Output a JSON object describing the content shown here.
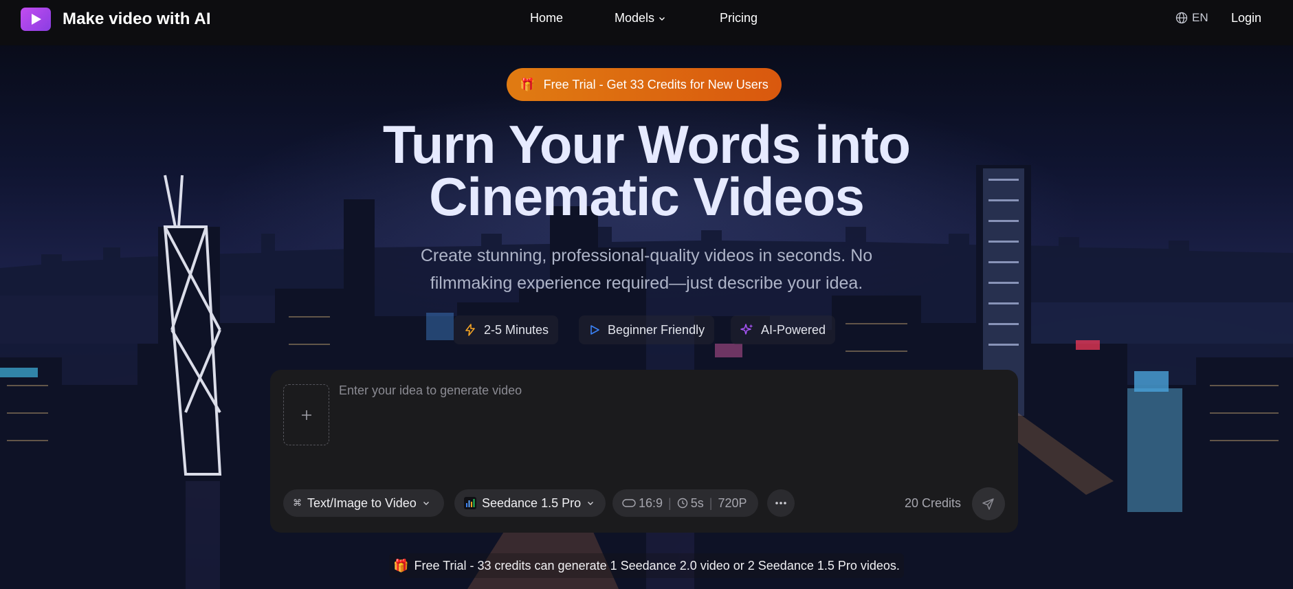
{
  "brand": {
    "name": "Make video with AI",
    "icon": "play-logo-icon",
    "accent": "#b548ee"
  },
  "nav": {
    "links": [
      {
        "label": "Home"
      },
      {
        "label": "Models",
        "icon": "chevron-down-icon"
      },
      {
        "label": "Pricing"
      }
    ],
    "language": {
      "label": "EN",
      "icon": "globe-icon"
    },
    "login_label": "Login"
  },
  "promo": {
    "label": "Free Trial - Get 33 Credits for New Users",
    "icon": "gift-icon",
    "color": "#e0700f"
  },
  "hero": {
    "title_line1": "Turn Your Words into",
    "title_line2": "Cinematic Videos",
    "subtitle_line1": "Create stunning, professional-quality videos in seconds. No",
    "subtitle_line2": "filmmaking experience required—just describe your idea."
  },
  "features": [
    {
      "label": "2-5 Minutes",
      "icon": "lightning-icon",
      "color": "#f5a524"
    },
    {
      "label": "Beginner Friendly",
      "icon": "play-outline-icon",
      "color": "#3b82f6"
    },
    {
      "label": "AI-Powered",
      "icon": "sparkles-icon",
      "color": "#a855f7"
    }
  ],
  "generator": {
    "upload_icon": "plus-icon",
    "prompt_placeholder": "Enter your idea to generate video",
    "mode_label": "Text/Image to Video",
    "mode_icon": "command-icon",
    "model_label": "Seedance 1.5 Pro",
    "model_icon": "bar-chart-icon",
    "aspect_ratio": "16:9",
    "duration": "5s",
    "resolution": "720P",
    "more_icon": "more-horizontal-icon",
    "credits_label": "20 Credits",
    "send_icon": "send-icon"
  },
  "bottom_note": {
    "label": "Free Trial - 33 credits can generate 1 Seedance 2.0 video or 2 Seedance 1.5 Pro videos.",
    "icon": "gift-icon"
  }
}
